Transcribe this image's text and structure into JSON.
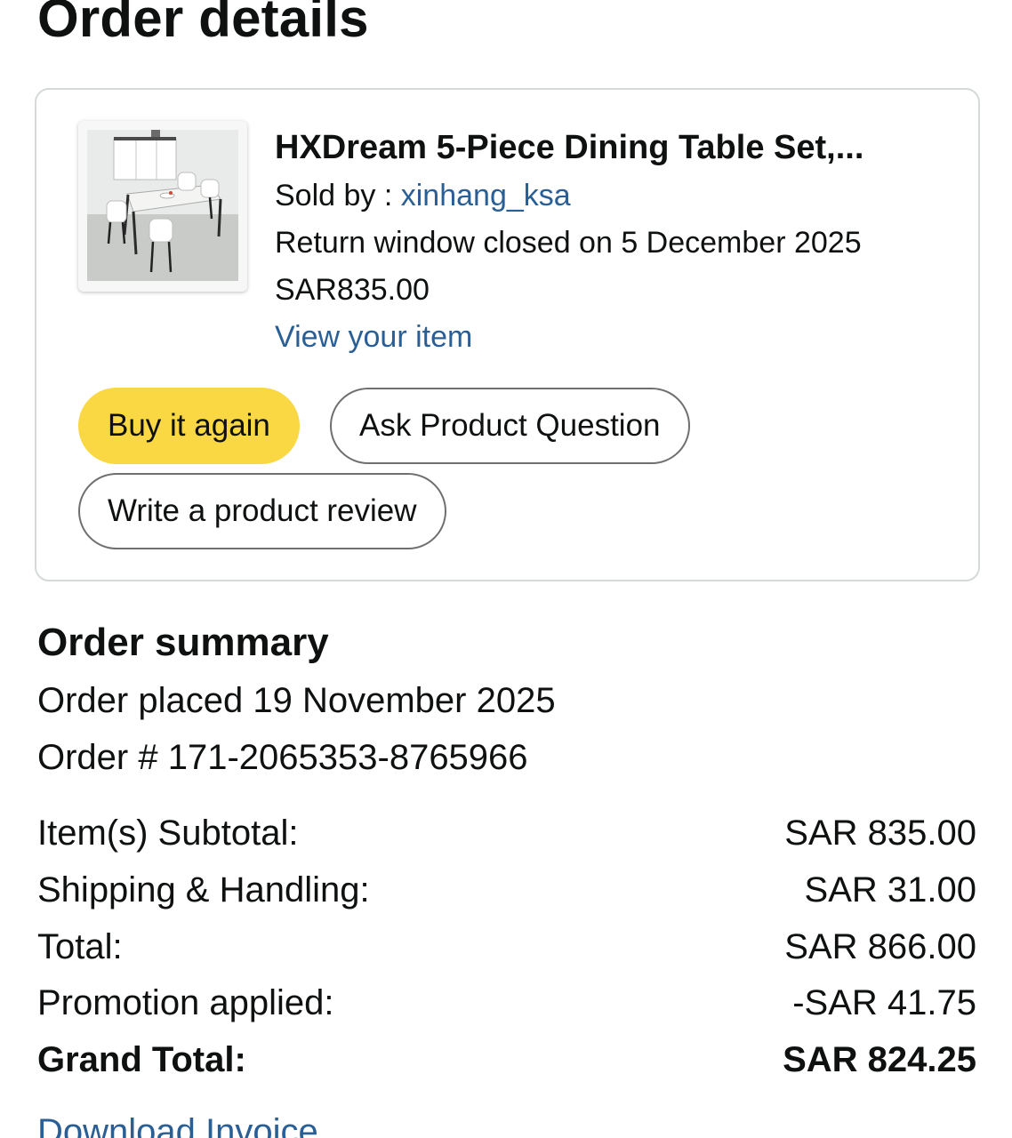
{
  "page_title": "Order details",
  "item": {
    "title": "HXDream 5-Piece Dining Table Set,...",
    "sold_by_label": "Sold by : ",
    "seller": "xinhang_ksa",
    "return_status": "Return window closed on 5 December 2025",
    "price": "SAR835.00",
    "view_link": "View your item",
    "image_description": "dining-table-set-photo"
  },
  "actions": {
    "buy_again": "Buy it again",
    "ask_question": "Ask Product Question",
    "write_review": "Write a product review"
  },
  "summary": {
    "title": "Order summary",
    "order_placed": "Order placed 19 November 2025",
    "order_number": "Order # 171-2065353-8765966",
    "rows": [
      {
        "label": "Item(s) Subtotal:",
        "value": "SAR 835.00"
      },
      {
        "label": "Shipping & Handling:",
        "value": "SAR 31.00"
      },
      {
        "label": "Total:",
        "value": "SAR 866.00"
      },
      {
        "label": "Promotion applied:",
        "value": "-SAR 41.75"
      },
      {
        "label": "Grand Total:",
        "value": "SAR 824.25"
      }
    ],
    "download_invoice": "Download Invoice"
  },
  "colors": {
    "link": "#2a5f96",
    "primary_button": "#fad844",
    "card_border": "#d5d9d9",
    "button_border": "#6e7070"
  }
}
